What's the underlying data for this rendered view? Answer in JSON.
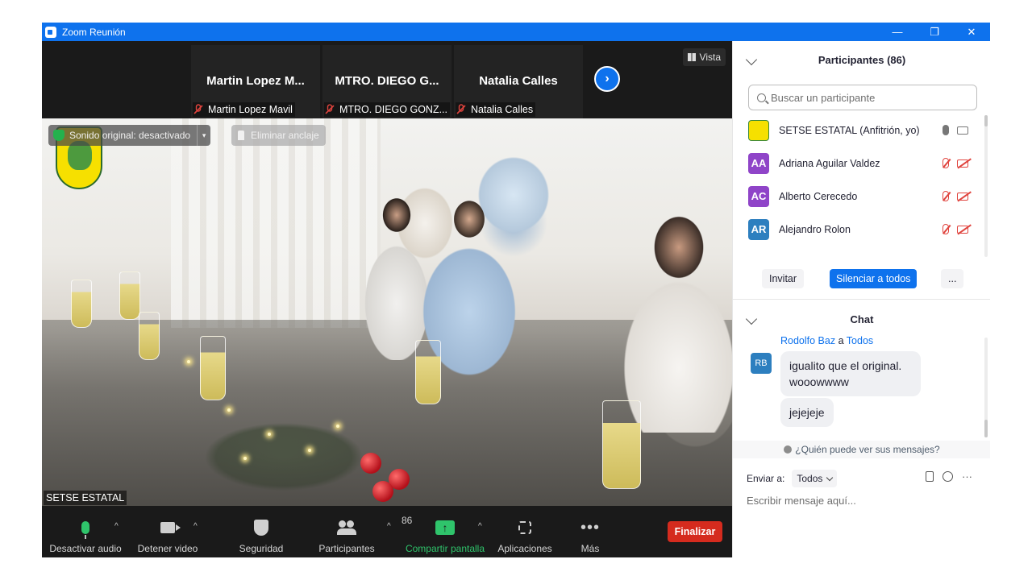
{
  "window": {
    "title": "Zoom Reunión",
    "controls": [
      "—",
      "❐",
      "✕"
    ]
  },
  "gallery": {
    "tiles": [
      {
        "display_name": "Martin  Lopez  M...",
        "label": "Martin Lopez Mavil"
      },
      {
        "display_name": "MTRO. DIEGO G...",
        "label": "MTRO. DIEGO GONZ..."
      },
      {
        "display_name": "Natalia Calles",
        "label": "Natalia Calles"
      }
    ],
    "next_arrow": "›",
    "view_label": "Vista"
  },
  "main_video": {
    "original_sound": "Sonido original: desactivado",
    "caret": "▾",
    "unpin": "Eliminar anclaje",
    "speaker": "SETSE ESTATAL"
  },
  "toolbar": {
    "mute_audio": "Desactivar audio",
    "stop_video": "Detener video",
    "security": "Seguridad",
    "participants": "Participantes",
    "participants_count": "86",
    "share_screen": "Compartir pantalla",
    "share_arrow": "↑",
    "apps": "Aplicaciones",
    "more": "Más",
    "more_dots": "•••",
    "end": "Finalizar",
    "caret": "^",
    "colors": {
      "end": "#d52b1e",
      "share": "#2fc46b",
      "mic": "#2fc46b"
    }
  },
  "participants_panel": {
    "title": "Participantes (86)",
    "search_placeholder": "Buscar un participante",
    "items": [
      {
        "initials": "",
        "name": "SETSE ESTATAL (Anfitrión, yo)",
        "color": "#f6e000",
        "muted": false
      },
      {
        "initials": "AA",
        "name": "Adriana Aguilar Valdez",
        "color": "#8f44c8",
        "muted": true
      },
      {
        "initials": "AC",
        "name": "Alberto Cerecedo",
        "color": "#8f44c8",
        "muted": true
      },
      {
        "initials": "AR",
        "name": "Alejandro Rolon",
        "color": "#2d7fbf",
        "muted": true
      }
    ],
    "invite": "Invitar",
    "mute_all": "Silenciar a todos",
    "more": "..."
  },
  "chat": {
    "title": "Chat",
    "message_from": "Rodolfo Baz",
    "message_sep": "a",
    "message_to": "Todos",
    "avatar_initials": "RB",
    "messages": [
      "igualito que el original. wooowwww",
      "jejejeje"
    ],
    "who_can_see": "¿Quién puede ver sus mensajes?",
    "send_to_label": "Enviar a:",
    "send_to_value": "Todos",
    "more_dots": "···",
    "input_placeholder": "Escribir mensaje aquí..."
  }
}
